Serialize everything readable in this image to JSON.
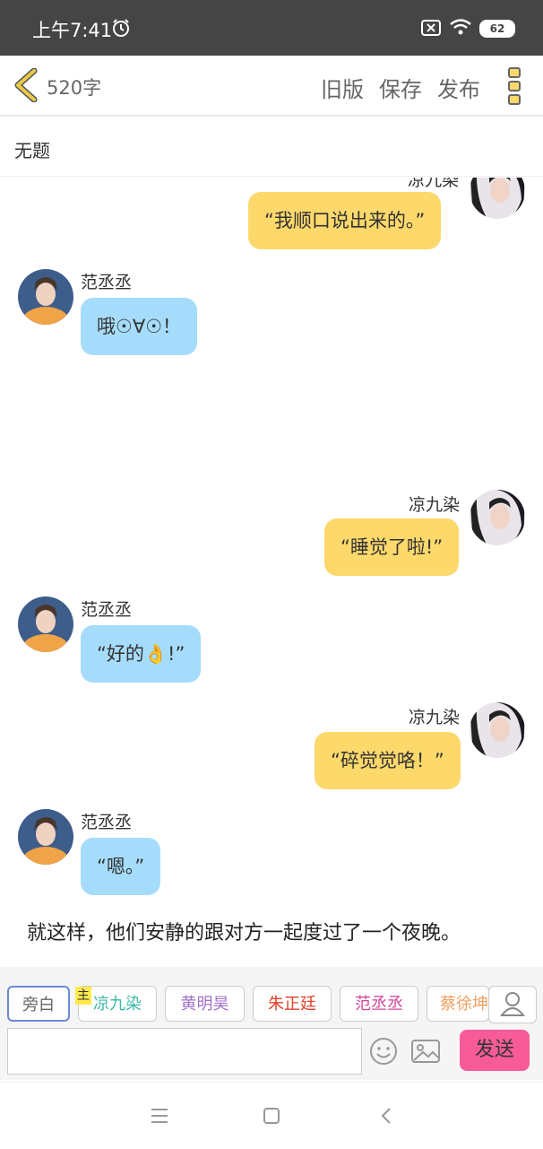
{
  "status_bar": {
    "time": "上午7:41",
    "battery": "62"
  },
  "header": {
    "word_count": "520字",
    "buttons": {
      "old_version": "旧版",
      "save": "保存",
      "publish": "发布"
    }
  },
  "title": "无题",
  "chat": {
    "partial_speaker": "凉九染",
    "messages": [
      {
        "speaker": "",
        "text": "“我顺口说出来的。”",
        "side": "right"
      },
      {
        "speaker": "范丞丞",
        "text": "哦☉∀☉！",
        "side": "left"
      },
      {
        "speaker": "凉九染",
        "text": "“睡觉了啦!”",
        "side": "right"
      },
      {
        "speaker": "范丞丞",
        "text": "“好的👌!”",
        "side": "left"
      },
      {
        "speaker": "凉九染",
        "text": "“碎觉觉咯！”",
        "side": "right"
      },
      {
        "speaker": "范丞丞",
        "text": "“嗯。”",
        "side": "left"
      }
    ],
    "narration": "就这样，他们安静的跟对方一起度过了一个夜晚。"
  },
  "characters": {
    "host_badge": "主",
    "items": [
      {
        "name": "旁白",
        "color": "#666666"
      },
      {
        "name": "凉九染",
        "color": "#3cb9a7"
      },
      {
        "name": "黄明昊",
        "color": "#a070c8"
      },
      {
        "name": "朱正廷",
        "color": "#e0402a"
      },
      {
        "name": "范丞丞",
        "color": "#d0459a"
      },
      {
        "name": "蔡徐坤",
        "color": "#f0a060"
      }
    ]
  },
  "composer": {
    "input_value": "",
    "send_label": "发送"
  },
  "colors": {
    "right_bubble": "#fdd86b",
    "left_bubble": "#a6dcfb",
    "send_button": "#f85c98",
    "back_icon": "#e9c846"
  },
  "icons": [
    "alarm-icon",
    "sim-icon",
    "wifi-icon",
    "battery-icon",
    "back-icon",
    "more-icon",
    "emoji-icon",
    "image-icon",
    "person-icon",
    "menu-icon",
    "home-icon",
    "back-nav-icon"
  ]
}
